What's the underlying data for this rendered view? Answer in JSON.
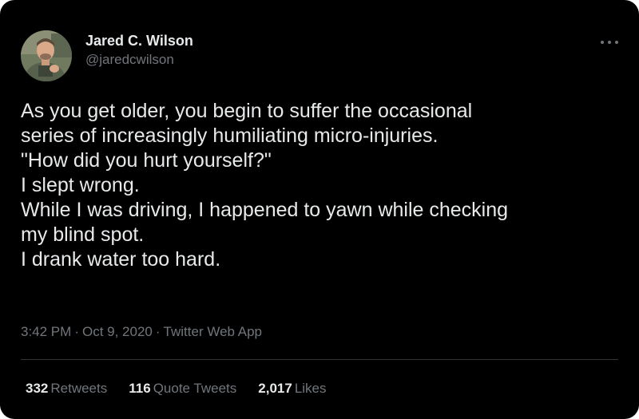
{
  "author": {
    "display_name": "Jared C. Wilson",
    "handle": "@jaredcwilson"
  },
  "tweet": {
    "lines": [
      "As you get older, you begin to suffer the occasional",
      "series of increasingly humiliating micro-injuries.",
      "\"How did you hurt yourself?\"",
      "I slept wrong.",
      "While I was driving, I happened to yawn while checking",
      "my blind spot.",
      "I drank water too hard."
    ]
  },
  "meta": {
    "time": "3:42 PM",
    "date": "Oct 9, 2020",
    "source": "Twitter Web App",
    "separator": "·"
  },
  "stats": {
    "retweets": {
      "count": "332",
      "label": "Retweets"
    },
    "quotes": {
      "count": "116",
      "label": "Quote Tweets"
    },
    "likes": {
      "count": "2,017",
      "label": "Likes"
    }
  },
  "icons": {
    "more": "more-horizontal-icon"
  },
  "colors": {
    "background": "#000000",
    "primary_text": "#e7e9ea",
    "secondary_text": "#71767b",
    "divider": "#2f3336"
  }
}
